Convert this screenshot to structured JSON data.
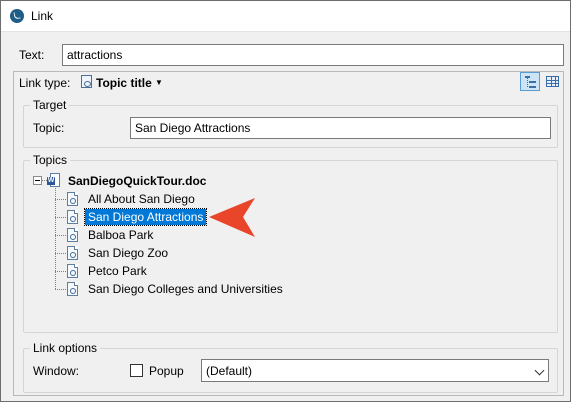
{
  "window": {
    "title": "Link"
  },
  "text_field": {
    "label": "Text:",
    "value": "attractions"
  },
  "link_type": {
    "label": "Link type:",
    "value": "Topic title"
  },
  "target": {
    "legend": "Target",
    "topic_label": "Topic:",
    "topic_value": "San Diego Attractions"
  },
  "topics": {
    "legend": "Topics",
    "root": "SanDiegoQuickTour.doc",
    "items": [
      {
        "label": "All About San Diego",
        "selected": false
      },
      {
        "label": "San Diego Attractions",
        "selected": true
      },
      {
        "label": "Balboa Park",
        "selected": false
      },
      {
        "label": "San Diego Zoo",
        "selected": false
      },
      {
        "label": "Petco Park",
        "selected": false
      },
      {
        "label": "San Diego Colleges and Universities",
        "selected": false
      }
    ]
  },
  "link_options": {
    "legend": "Link options",
    "window_label": "Window:",
    "popup_label": "Popup",
    "popup_checked": false,
    "window_value": "(Default)"
  },
  "colors": {
    "selection": "#0078d7",
    "pointer_arrow": "#e8452a",
    "app_icon": "#1f5c86"
  },
  "icons": [
    "app-icon",
    "topic-icon",
    "word-doc-icon",
    "tree-view-icon",
    "table-view-icon",
    "pointer-arrow"
  ]
}
